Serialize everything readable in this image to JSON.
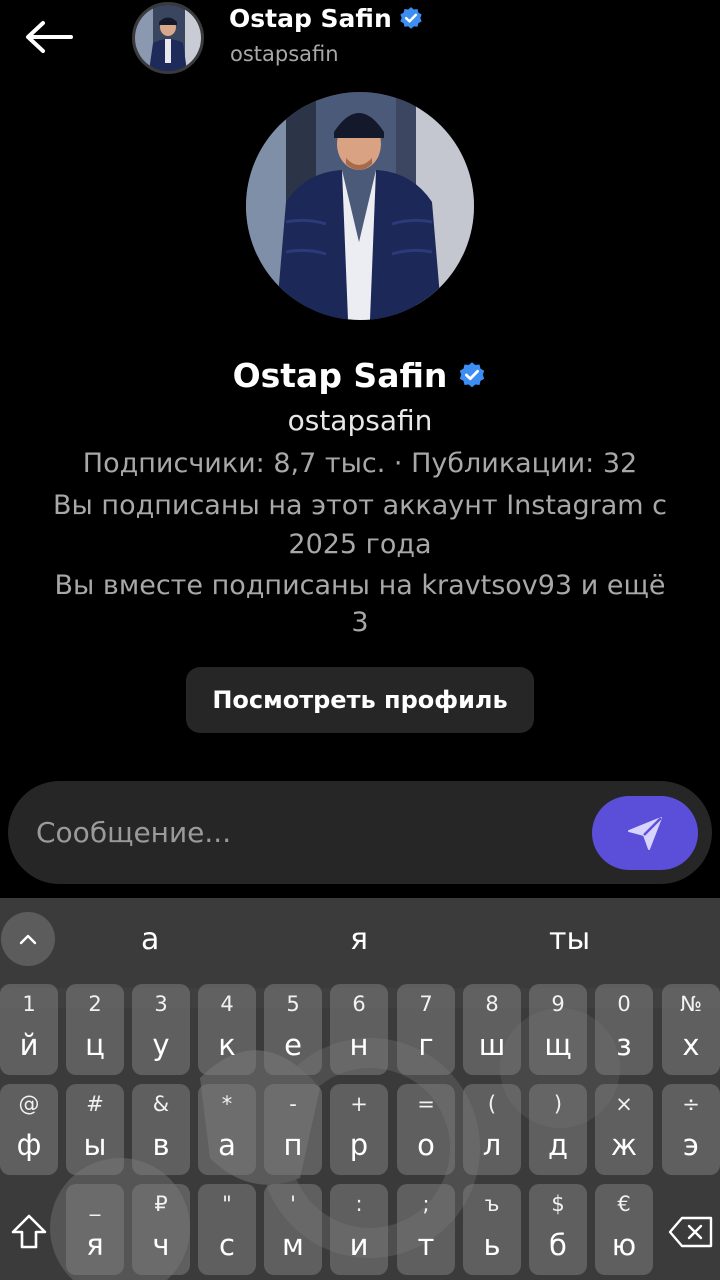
{
  "header": {
    "name": "Ostap Safin",
    "username": "ostapsafin"
  },
  "profile": {
    "name": "Ostap Safin",
    "username": "ostapsafin",
    "stats": "Подписчики: 8,7 тыс. · Публикации: 32",
    "following_line1": "Вы подписаны на этот аккаунт Instagram с",
    "following_line2": "2025 года",
    "mutual_line1": "Вы вместе подписаны на kravtsov93 и ещё",
    "mutual_line2": "3",
    "view_profile_label": "Посмотреть профиль"
  },
  "message": {
    "placeholder": "Сообщение..."
  },
  "colors": {
    "accent": "#5b4fd9",
    "verified": "#3d8ef2",
    "button_bg": "#262626"
  },
  "keyboard": {
    "suggestions": [
      "а",
      "я",
      "ты"
    ],
    "row1": [
      {
        "sym": "1",
        "main": "й"
      },
      {
        "sym": "2",
        "main": "ц"
      },
      {
        "sym": "3",
        "main": "у"
      },
      {
        "sym": "4",
        "main": "к"
      },
      {
        "sym": "5",
        "main": "е"
      },
      {
        "sym": "6",
        "main": "н"
      },
      {
        "sym": "7",
        "main": "г"
      },
      {
        "sym": "8",
        "main": "ш"
      },
      {
        "sym": "9",
        "main": "щ"
      },
      {
        "sym": "0",
        "main": "з"
      },
      {
        "sym": "№",
        "main": "х"
      }
    ],
    "row2": [
      {
        "sym": "@",
        "main": "ф"
      },
      {
        "sym": "#",
        "main": "ы"
      },
      {
        "sym": "&",
        "main": "в"
      },
      {
        "sym": "*",
        "main": "а"
      },
      {
        "sym": "-",
        "main": "п"
      },
      {
        "sym": "+",
        "main": "р"
      },
      {
        "sym": "=",
        "main": "о"
      },
      {
        "sym": "(",
        "main": "л"
      },
      {
        "sym": ")",
        "main": "д"
      },
      {
        "sym": "×",
        "main": "ж"
      },
      {
        "sym": "÷",
        "main": "э"
      }
    ],
    "row3": [
      {
        "sym": "_",
        "main": "я"
      },
      {
        "sym": "₽",
        "main": "ч"
      },
      {
        "sym": "\"",
        "main": "с"
      },
      {
        "sym": "'",
        "main": "м"
      },
      {
        "sym": ":",
        "main": "и"
      },
      {
        "sym": ";",
        "main": "т"
      },
      {
        "sym": "ъ",
        "main": "ь"
      },
      {
        "sym": "$",
        "main": "б"
      },
      {
        "sym": "€",
        "main": "ю"
      }
    ]
  }
}
